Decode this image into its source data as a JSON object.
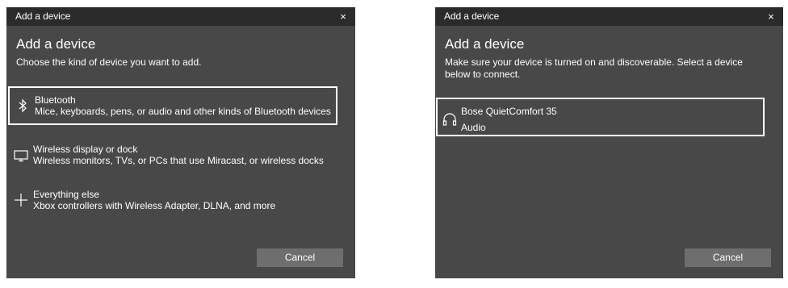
{
  "left_dialog": {
    "title_bar": "Add a device",
    "close_glyph": "×",
    "heading": "Add a device",
    "subtext": "Choose the kind of device you want to add.",
    "options": [
      {
        "icon": "bluetooth-icon",
        "title": "Bluetooth",
        "description": "Mice, keyboards, pens, or audio and other kinds of Bluetooth devices",
        "selected": true
      },
      {
        "icon": "monitor-icon",
        "title": "Wireless display or dock",
        "description": "Wireless monitors, TVs, or PCs that use Miracast, or wireless docks",
        "selected": false
      },
      {
        "icon": "plus-icon",
        "title": "Everything else",
        "description": "Xbox controllers with Wireless Adapter, DLNA, and more",
        "selected": false
      }
    ],
    "cancel_label": "Cancel"
  },
  "right_dialog": {
    "title_bar": "Add a device",
    "close_glyph": "×",
    "heading": "Add a device",
    "subtext": "Make sure your device is turned on and discoverable. Select a device below to connect.",
    "devices": [
      {
        "icon": "headphones-icon",
        "name": "Bose QuietComfort 35",
        "type": "Audio",
        "selected": true
      }
    ],
    "cancel_label": "Cancel"
  },
  "colors": {
    "dialog_bg": "#484848",
    "titlebar_bg": "#2b2b2b",
    "button_bg": "#6e6e6e",
    "text": "#ffffff",
    "selection_border": "#ffffff"
  }
}
